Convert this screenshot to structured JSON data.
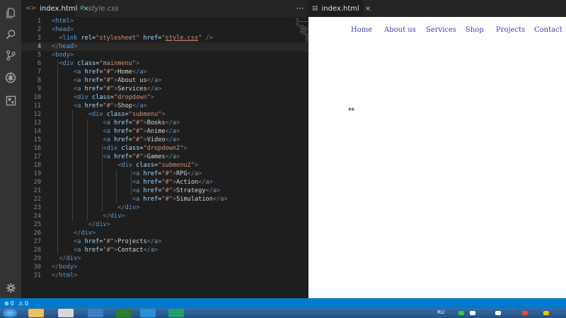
{
  "editor": {
    "tabs": [
      {
        "label": "index.html",
        "icon": "html-file-icon",
        "active": true
      },
      {
        "label": "style.css",
        "icon": "css-file-icon",
        "active": false
      }
    ],
    "more": "···",
    "current_line": 4,
    "lines": [
      {
        "n": "1",
        "indent": 0,
        "html": "<span class='p'>&lt;</span><span class='t'>html</span><span class='p'>&gt;</span>"
      },
      {
        "n": "2",
        "indent": 0,
        "html": "<span class='p'>&lt;</span><span class='t'>head</span><span class='p'>&gt;</span>"
      },
      {
        "n": "3",
        "indent": 1,
        "html": "<span class='p'>&lt;</span><span class='t'>link</span> <span class='a'>rel</span><span class='x'>=</span><span class='s'>\"stylesheet\"</span> <span class='a'>href</span><span class='x'>=</span><span class='s'>\"<span class='u'>style.css</span>\"</span> <span class='p'>/&gt;</span>"
      },
      {
        "n": "4",
        "indent": 0,
        "html": "<span class='p'>&lt;/</span><span class='t'>head</span><span class='p'>&gt;</span>"
      },
      {
        "n": "5",
        "indent": 0,
        "html": "<span class='p'>&lt;</span><span class='t'>body</span><span class='p'>&gt;</span>"
      },
      {
        "n": "6",
        "indent": 1,
        "html": "<span class='p'>&lt;</span><span class='t'>div</span> <span class='a'>class</span><span class='x'>=</span><span class='s'>\"mainmenu\"</span><span class='p'>&gt;</span>"
      },
      {
        "n": "7",
        "indent": 3,
        "html": "<span class='p'>&lt;</span><span class='t'>a</span> <span class='a'>href</span><span class='x'>=</span><span class='s'>\"#\"</span><span class='p'>&gt;</span><span class='x'>Home</span><span class='p'>&lt;/</span><span class='t'>a</span><span class='p'>&gt;</span>"
      },
      {
        "n": "8",
        "indent": 3,
        "html": "<span class='p'>&lt;</span><span class='t'>a</span> <span class='a'>href</span><span class='x'>=</span><span class='s'>\"#\"</span><span class='p'>&gt;</span><span class='x'>About us</span><span class='p'>&lt;/</span><span class='t'>a</span><span class='p'>&gt;</span>"
      },
      {
        "n": "9",
        "indent": 3,
        "html": "<span class='p'>&lt;</span><span class='t'>a</span> <span class='a'>href</span><span class='x'>=</span><span class='s'>\"#\"</span><span class='p'>&gt;</span><span class='x'>Services</span><span class='p'>&lt;/</span><span class='t'>a</span><span class='p'>&gt;</span>"
      },
      {
        "n": "10",
        "indent": 3,
        "html": "<span class='p'>&lt;</span><span class='t'>div</span> <span class='a'>class</span><span class='x'>=</span><span class='s'>\"dropdown\"</span><span class='p'>&gt;</span>"
      },
      {
        "n": "11",
        "indent": 3,
        "html": "<span class='p'>&lt;</span><span class='t'>a</span> <span class='a'>href</span><span class='x'>=</span><span class='s'>\"#\"</span><span class='p'>&gt;</span><span class='x'>Shop</span><span class='p'>&lt;/</span><span class='t'>a</span><span class='p'>&gt;</span>"
      },
      {
        "n": "12",
        "indent": 5,
        "html": "<span class='p'>&lt;</span><span class='t'>div</span> <span class='a'>class</span><span class='x'>=</span><span class='s'>\"submenu\"</span><span class='p'>&gt;</span>"
      },
      {
        "n": "13",
        "indent": 7,
        "html": "<span class='p'>&lt;</span><span class='t'>a</span> <span class='a'>href</span><span class='x'>=</span><span class='s'>\"#\"</span><span class='p'>&gt;</span><span class='x'>Books</span><span class='p'>&lt;/</span><span class='t'>a</span><span class='p'>&gt;</span>"
      },
      {
        "n": "14",
        "indent": 7,
        "html": "<span class='p'>&lt;</span><span class='t'>a</span> <span class='a'>href</span><span class='x'>=</span><span class='s'>\"#\"</span><span class='p'>&gt;</span><span class='x'>Anime</span><span class='p'>&lt;/</span><span class='t'>a</span><span class='p'>&gt;</span>"
      },
      {
        "n": "15",
        "indent": 7,
        "html": "<span class='p'>&lt;</span><span class='t'>a</span> <span class='a'>href</span><span class='x'>=</span><span class='s'>\"#\"</span><span class='p'>&gt;</span><span class='x'>Video</span><span class='p'>&lt;/</span><span class='t'>a</span><span class='p'>&gt;</span>"
      },
      {
        "n": "16",
        "indent": 7,
        "html": "<span class='p'>&lt;</span><span class='t'>div</span> <span class='a'>class</span><span class='x'>=</span><span class='s'>\"dropdown2\"</span><span class='p'>&gt;</span>"
      },
      {
        "n": "17",
        "indent": 7,
        "html": "<span class='p'>&lt;</span><span class='t'>a</span> <span class='a'>href</span><span class='x'>=</span><span class='s'>\"#\"</span><span class='p'>&gt;</span><span class='x'>Games</span><span class='p'>&lt;/</span><span class='t'>a</span><span class='p'>&gt;</span>"
      },
      {
        "n": "18",
        "indent": 9,
        "html": "<span class='p'>&lt;</span><span class='t'>div</span> <span class='a'>class</span><span class='x'>=</span><span class='s'>\"submenu2\"</span><span class='p'>&gt;</span>"
      },
      {
        "n": "19",
        "indent": 11,
        "html": "<span class='p'>&lt;</span><span class='t'>a</span> <span class='a'>href</span><span class='x'>=</span><span class='s'>\"#\"</span><span class='p'>&gt;</span><span class='x'>RPG</span><span class='p'>&lt;/</span><span class='t'>a</span><span class='p'>&gt;</span>"
      },
      {
        "n": "20",
        "indent": 11,
        "html": "<span class='p'>&lt;</span><span class='t'>a</span> <span class='a'>href</span><span class='x'>=</span><span class='s'>\"#\"</span><span class='p'>&gt;</span><span class='x'>Action</span><span class='p'>&lt;/</span><span class='t'>a</span><span class='p'>&gt;</span>"
      },
      {
        "n": "21",
        "indent": 11,
        "html": "<span class='p'>&lt;</span><span class='t'>a</span> <span class='a'>href</span><span class='x'>=</span><span class='s'>\"#\"</span><span class='p'>&gt;</span><span class='x'>Strategy</span><span class='p'>&lt;/</span><span class='t'>a</span><span class='p'>&gt;</span>"
      },
      {
        "n": "22",
        "indent": 11,
        "html": "<span class='p'>&lt;</span><span class='t'>a</span> <span class='a'>href</span><span class='x'>=</span><span class='s'>\"#\"</span><span class='p'>&gt;</span><span class='x'>Simulation</span><span class='p'>&lt;/</span><span class='t'>a</span><span class='p'>&gt;</span>"
      },
      {
        "n": "23",
        "indent": 9,
        "html": "<span class='p'>&lt;/</span><span class='t'>div</span><span class='p'>&gt;</span>"
      },
      {
        "n": "24",
        "indent": 7,
        "html": "<span class='p'>&lt;/</span><span class='t'>div</span><span class='p'>&gt;</span>"
      },
      {
        "n": "25",
        "indent": 5,
        "html": "<span class='p'>&lt;/</span><span class='t'>div</span><span class='p'>&gt;</span>"
      },
      {
        "n": "26",
        "indent": 3,
        "html": "<span class='p'>&lt;/</span><span class='t'>div</span><span class='p'>&gt;</span>"
      },
      {
        "n": "27",
        "indent": 3,
        "html": "<span class='p'>&lt;</span><span class='t'>a</span> <span class='a'>href</span><span class='x'>=</span><span class='s'>\"#\"</span><span class='p'>&gt;</span><span class='x'>Projects</span><span class='p'>&lt;/</span><span class='t'>a</span><span class='p'>&gt;</span>"
      },
      {
        "n": "28",
        "indent": 3,
        "html": "<span class='p'>&lt;</span><span class='t'>a</span> <span class='a'>href</span><span class='x'>=</span><span class='s'>\"#\"</span><span class='p'>&gt;</span><span class='x'>Contact</span><span class='p'>&lt;/</span><span class='t'>a</span><span class='p'>&gt;</span>"
      },
      {
        "n": "29",
        "indent": 1,
        "html": "<span class='p'>&lt;/</span><span class='t'>div</span><span class='p'>&gt;</span>"
      },
      {
        "n": "30",
        "indent": 0,
        "html": "<span class='p'>&lt;/</span><span class='t'>body</span><span class='p'>&gt;</span>"
      },
      {
        "n": "31",
        "indent": 0,
        "html": "<span class='p'>&lt;/</span><span class='t'>html</span><span class='p'>&gt;</span>"
      }
    ]
  },
  "activity_bar": [
    "files-icon",
    "search-icon",
    "source-control-icon",
    "debug-icon",
    "extensions-icon",
    "settings-gear-icon"
  ],
  "preview": {
    "tab_label": "index.html",
    "nav": [
      "Home",
      "About us",
      "Services",
      "Shop",
      "Projects",
      "Contact"
    ],
    "link_color": "#3a3fa6"
  },
  "status": {
    "errors": "0",
    "warnings": "0",
    "accent": "#007acc"
  },
  "taskbar": {
    "lang": "RU"
  }
}
